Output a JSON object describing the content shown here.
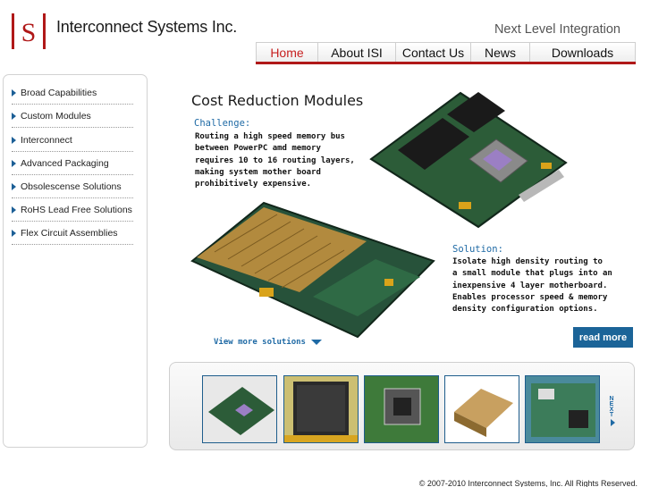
{
  "header": {
    "logo_text": "ISI",
    "company": "Interconnect Systems Inc.",
    "tagline": "Next Level Integration",
    "brand_color": "#b01818"
  },
  "nav": {
    "items": [
      "Home",
      "About ISI",
      "Contact Us",
      "News",
      "Downloads"
    ],
    "active": "Home"
  },
  "sidebar": {
    "items": [
      "Broad Capabilities",
      "Custom Modules",
      "Interconnect",
      "Advanced Packaging",
      "Obsolescense Solutions",
      "RoHS Lead Free Solutions",
      "Flex Circuit Assemblies"
    ]
  },
  "feature": {
    "title": "Cost Reduction Modules",
    "challenge_head": "Challenge:",
    "challenge_body": "Routing a high speed memory bus\nbetween PowerPC amd memory\nrequires 10 to 16 routing layers,\nmaking system mother board\nprohibitively expensive.",
    "solution_head": "Solution:",
    "solution_body": "Isolate high density routing to\na small module that plugs into an\ninexpensive 4 layer motherboard.\nEnables processor speed & memory\ndensity configuration options.",
    "view_more": "View more solutions",
    "read_more": "read more"
  },
  "strip": {
    "next_label": "NEXT",
    "thumbnails": [
      "module-board",
      "bga-chip",
      "chip-carrier",
      "gold-connector",
      "circuit-board"
    ]
  },
  "footer": {
    "copyright": "© 2007-2010 Interconnect Systems, Inc. All Rights Reserved."
  }
}
